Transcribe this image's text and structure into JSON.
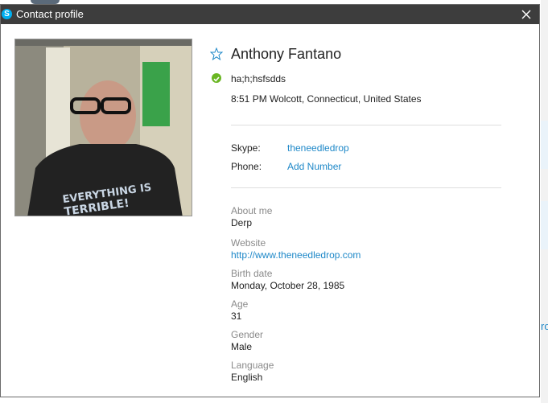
{
  "window": {
    "title": "Contact profile",
    "logo": "S"
  },
  "background": {
    "partial_link": "ro"
  },
  "profile": {
    "name": "Anthony Fantano",
    "mood": "ha;h;hsfsdds",
    "location": "8:51 PM Wolcott, Connecticut, United States",
    "status_color": "#6ab623",
    "shirt_text_line1": "EVERYTHING IS",
    "shirt_text_line2": "TERRIBLE!"
  },
  "contact_fields": {
    "skype_label": "Skype:",
    "skype_value": "theneedledrop",
    "phone_label": "Phone:",
    "phone_value": "Add Number"
  },
  "details": [
    {
      "label": "About me",
      "value": "Derp"
    },
    {
      "label": "Website",
      "value": "http://www.theneedledrop.com"
    },
    {
      "label": "Birth date",
      "value": "Monday, October 28, 1985"
    },
    {
      "label": "Age",
      "value": "31"
    },
    {
      "label": "Gender",
      "value": "Male"
    },
    {
      "label": "Language",
      "value": "English"
    }
  ],
  "colors": {
    "titlebar": "#3d3d3d",
    "link": "#1e88c8",
    "accent": "#00aff0"
  }
}
